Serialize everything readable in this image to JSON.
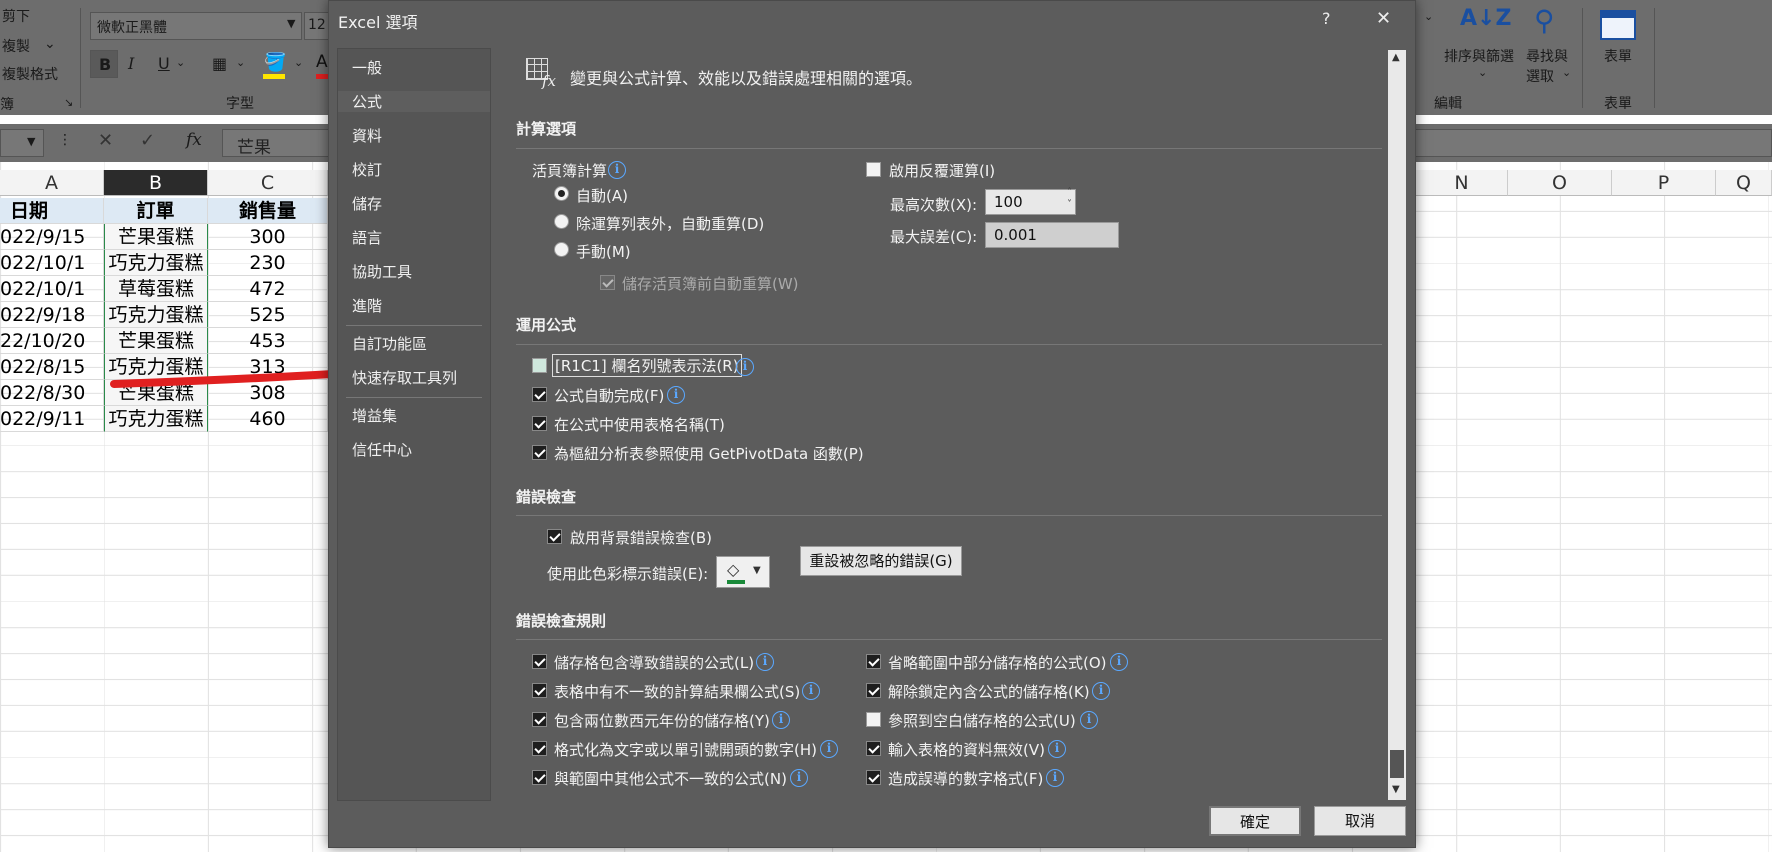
{
  "ribbon": {
    "clipboard": {
      "cut": "剪下",
      "copy": "複製",
      "format_painter": "複製格式"
    },
    "font": {
      "name": "微軟正黑體",
      "size": "12",
      "group_label": "字型"
    },
    "editing": {
      "sort_filter": "排序與篩選",
      "find_select_1": "尋找與",
      "find_select_2": "選取",
      "group_label": "編輯"
    },
    "form": {
      "label": "表單",
      "group_label": "表單"
    }
  },
  "formula_bar": {
    "fx": "fx",
    "content": "芒果"
  },
  "sheet": {
    "col_headers_left": [
      "A",
      "B",
      "C"
    ],
    "col_headers_right": [
      "N",
      "O",
      "P",
      "Q"
    ],
    "header_row": [
      "日期",
      "訂單",
      "銷售量"
    ],
    "rows": [
      [
        "022/9/15",
        "芒果蛋糕",
        "300"
      ],
      [
        "022/10/1",
        "巧克力蛋糕",
        "230"
      ],
      [
        "022/10/1",
        "草莓蛋糕",
        "472"
      ],
      [
        "022/9/18",
        "巧克力蛋糕",
        "525"
      ],
      [
        "22/10/20",
        "芒果蛋糕",
        "453"
      ],
      [
        "022/8/15",
        "巧克力蛋糕",
        "313"
      ],
      [
        "022/8/30",
        "芒果蛋糕",
        "308"
      ],
      [
        "022/9/11",
        "巧克力蛋糕",
        "460"
      ]
    ]
  },
  "dialog": {
    "title": "Excel 選項",
    "help": "?",
    "close": "✕",
    "nav": [
      "一般",
      "公式",
      "資料",
      "校訂",
      "儲存",
      "語言",
      "協助工具",
      "進階",
      "自訂功能區",
      "快速存取工具列",
      "增益集",
      "信任中心"
    ],
    "header": "變更與公式計算、效能以及錯誤處理相關的選項。",
    "calc": {
      "section": "計算選項",
      "workbook_calc": "活頁簿計算",
      "auto": "自動(A)",
      "auto_except_tables": "除運算列表外，自動重算(D)",
      "manual": "手動(M)",
      "recalc_before_save": "儲存活頁簿前自動重算(W)",
      "iterative": "啟用反覆運算(I)",
      "max_iterations_label": "最高次數(X):",
      "max_iterations_value": "100",
      "max_change_label": "最大誤差(C):",
      "max_change_value": "0.001"
    },
    "formulas": {
      "section": "運用公式",
      "r1c1": "[R1C1] 欄名列號表示法(R)",
      "autocomplete": "公式自動完成(F)",
      "table_names": "在公式中使用表格名稱(T)",
      "getpivotdata": "為樞紐分析表參照使用 GetPivotData 函數(P)"
    },
    "error_check": {
      "section": "錯誤檢查",
      "enable_bg": "啟用背景錯誤檢查(B)",
      "color_label": "使用此色彩標示錯誤(E):",
      "reset_button": "重設被忽略的錯誤(G)"
    },
    "rules": {
      "section": "錯誤檢查規則",
      "left": [
        "儲存格包含導致錯誤的公式(L)",
        "表格中有不一致的計算結果欄公式(S)",
        "包含兩位數西元年份的儲存格(Y)",
        "格式化為文字或以單引號開頭的數字(H)",
        "與範圍中其他公式不一致的公式(N)"
      ],
      "right": [
        "省略範圍中部分儲存格的公式(O)",
        "解除鎖定內含公式的儲存格(K)",
        "參照到空白儲存格的公式(U)",
        "輸入表格的資料無效(V)",
        "造成誤導的數字格式(F)"
      ]
    },
    "ok": "確定",
    "cancel": "取消"
  },
  "annotation": {
    "arrow_color": "#e02020"
  }
}
